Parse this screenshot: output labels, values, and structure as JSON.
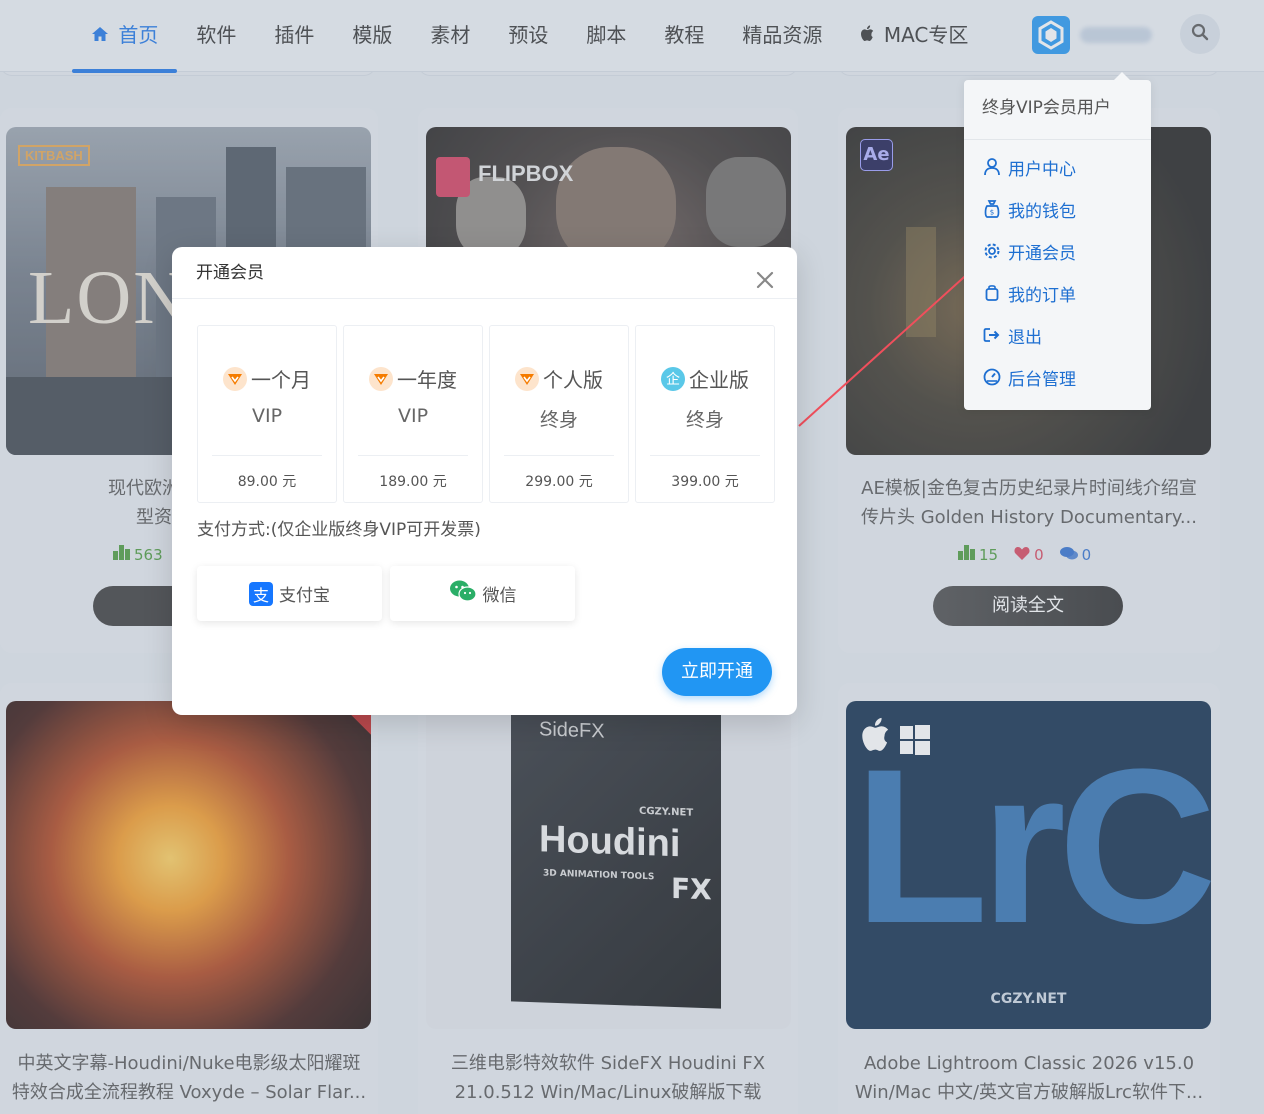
{
  "nav": {
    "items": [
      {
        "label": "首页",
        "icon": "home-icon"
      },
      {
        "label": "软件"
      },
      {
        "label": "插件"
      },
      {
        "label": "模版"
      },
      {
        "label": "素材"
      },
      {
        "label": "预设"
      },
      {
        "label": "脚本"
      },
      {
        "label": "教程"
      },
      {
        "label": "精品资源"
      },
      {
        "label": "MAC专区",
        "icon": "apple-icon"
      }
    ],
    "active_index": 0,
    "accent": "#1a73e8"
  },
  "cards": [
    {
      "thumb_text": "KITBASH",
      "thumb_text2": "LON",
      "title_line1": "现代欧洲伦敦建筑模",
      "title_line2": "型资产 Kitba",
      "views": "563",
      "read_label": "阅"
    },
    {
      "thumb_text": "FLIPBOX"
    },
    {
      "thumb_badge": "Ae",
      "title_line1": "AE模板|金色复古历史纪录片时间线介绍宣",
      "title_line2": "传片头 Golden History Documentary...",
      "views": "15",
      "likes": "0",
      "comments": "0",
      "read_label": "阅读全文"
    },
    {
      "title_line1": "中英文字幕-Houdini/Nuke电影级太阳耀斑",
      "title_line2": "特效合成全流程教程 Voxyde – Solar Flar..."
    },
    {
      "thumb_brand": "SideFX",
      "thumb_site": "CGZY.NET",
      "thumb_title": "Houdini",
      "thumb_sub": "3D ANIMATION TOOLS",
      "thumb_fx": "FX",
      "title_line1": "三维电影特效软件 SideFX Houdini FX",
      "title_line2": "21.0.512 Win/Mac/Linux破解版下载"
    },
    {
      "thumb_big": "LrC",
      "thumb_site": "CGZY.NET",
      "title_line1": "Adobe Lightroom Classic 2026 v15.0",
      "title_line2": "Win/Mac 中文/英文官方破解版Lrc软件下..."
    }
  ],
  "dropdown": {
    "header": "终身VIP会员用户",
    "items": [
      {
        "label": "用户中心",
        "icon": "user-icon"
      },
      {
        "label": "我的钱包",
        "icon": "wallet-icon"
      },
      {
        "label": "开通会员",
        "icon": "gear-icon"
      },
      {
        "label": "我的订单",
        "icon": "order-icon"
      },
      {
        "label": "退出",
        "icon": "logout-icon"
      },
      {
        "label": "后台管理",
        "icon": "dashboard-icon"
      }
    ]
  },
  "modal": {
    "title": "开通会员",
    "plans": [
      {
        "name": "一个月",
        "sub": "VIP",
        "price": "89.00 元",
        "badge": "vip-badge-icon"
      },
      {
        "name": "一年度",
        "sub": "VIP",
        "price": "189.00 元",
        "badge": "vip-badge-icon"
      },
      {
        "name": "个人版",
        "sub": "终身",
        "price": "299.00 元",
        "badge": "vip-badge-icon"
      },
      {
        "name": "企业版",
        "sub": "终身",
        "price": "399.00 元",
        "badge": "enterprise-badge-icon",
        "badge_char": "企"
      }
    ],
    "pay_label": "支付方式:(仅企业版终身VIP可开发票)",
    "pay_options": [
      {
        "label": "支付宝",
        "icon": "alipay-icon",
        "icon_char": "支"
      },
      {
        "label": "微信",
        "icon": "wechat-icon"
      }
    ],
    "submit_label": "立即开通",
    "colors": {
      "primary": "#2196f3",
      "vip_badge": "#f57c00",
      "alipay": "#1677ff",
      "wechat": "#2aae67"
    }
  }
}
